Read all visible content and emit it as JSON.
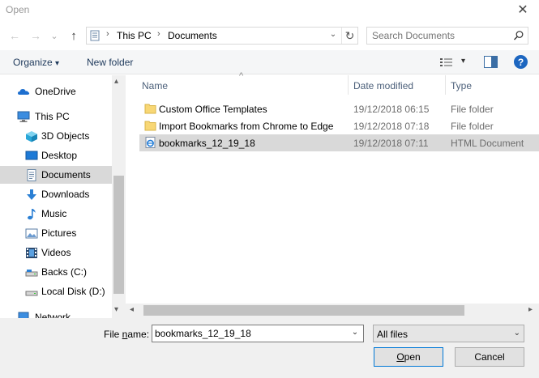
{
  "window": {
    "title": "Open",
    "close_glyph": "✕"
  },
  "nav": {
    "back_glyph": "←",
    "forward_glyph": "→",
    "recent_glyph": "⌄",
    "up_glyph": "↑",
    "breadcrumb": [
      "This PC",
      "Documents"
    ],
    "separator": "›",
    "dropdown_glyph": "⌄",
    "refresh_glyph": "↻"
  },
  "search": {
    "placeholder": "Search Documents"
  },
  "toolbar": {
    "organize_label": "Organize",
    "organize_arrow": "▾",
    "new_folder_label": "New folder",
    "view_arrow": "▾",
    "help_glyph": "?"
  },
  "sidebar": {
    "items": [
      {
        "label": "OneDrive",
        "icon": "onedrive-icon"
      },
      {
        "label": "This PC",
        "icon": "computer-icon"
      },
      {
        "label": "3D Objects",
        "icon": "cube-icon"
      },
      {
        "label": "Desktop",
        "icon": "desktop-icon"
      },
      {
        "label": "Documents",
        "icon": "document-icon",
        "selected": true
      },
      {
        "label": "Downloads",
        "icon": "download-icon"
      },
      {
        "label": "Music",
        "icon": "music-icon"
      },
      {
        "label": "Pictures",
        "icon": "picture-icon"
      },
      {
        "label": "Videos",
        "icon": "video-icon"
      },
      {
        "label": "Backs (C:)",
        "icon": "drive-icon"
      },
      {
        "label": "Local Disk (D:)",
        "icon": "drive-icon"
      },
      {
        "label": "Network",
        "icon": "network-icon"
      }
    ]
  },
  "filelist": {
    "sort_glyph": "^",
    "columns": {
      "name": "Name",
      "date": "Date modified",
      "type": "Type"
    },
    "rows": [
      {
        "name": "Custom Office Templates",
        "date": "19/12/2018 06:15",
        "type": "File folder",
        "icon": "folder-icon"
      },
      {
        "name": "Import Bookmarks from Chrome to Edge",
        "date": "19/12/2018 07:18",
        "type": "File folder",
        "icon": "folder-icon"
      },
      {
        "name": "bookmarks_12_19_18",
        "date": "19/12/2018 07:11",
        "type": "HTML Document",
        "icon": "html-file-icon",
        "selected": true
      }
    ]
  },
  "scroll": {
    "up_glyph": "▴",
    "down_glyph": "▾",
    "left_glyph": "◂",
    "right_glyph": "▸"
  },
  "bottom": {
    "file_name_label_pre": "File ",
    "file_name_label_u": "n",
    "file_name_label_post": "ame:",
    "file_name_value": "bookmarks_12_19_18",
    "dropdown_glyph": "⌄",
    "file_type_value": "All files",
    "open_pre": "",
    "open_u": "O",
    "open_post": "pen",
    "cancel_label": "Cancel"
  },
  "colors": {
    "selection": "#d9d9d9",
    "accent": "#0078d7",
    "folder": "#f8d775"
  }
}
